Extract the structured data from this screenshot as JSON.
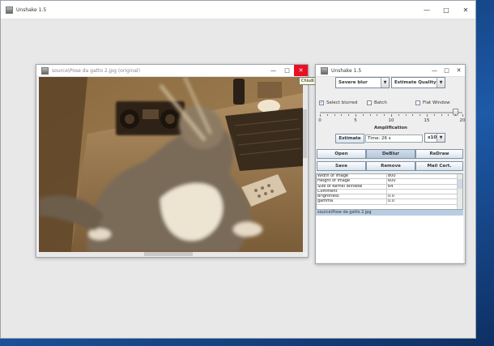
{
  "main_window": {
    "title": "Unshake 1.5"
  },
  "image_window": {
    "title": "source\\Pose da gatto 2.jpg (original)",
    "tooltip": "Chiudi"
  },
  "control_window": {
    "title": "Unshake 1.5",
    "blur_select": "Severe blur",
    "mode_select": "Estimate Quality",
    "select_blurred_label": "Select blurred",
    "select_blurred_checked": true,
    "batch_label": "Batch",
    "batch_checked": false,
    "flat_window_label": "Flat Window",
    "flat_window_checked": false,
    "amplification": {
      "label": "Amplification",
      "ticks": [
        "0",
        "5",
        "10",
        "15",
        "20"
      ],
      "value": 19
    },
    "estimate_button": "Estimate",
    "time_text": "Time: 26 s",
    "kernel_select": "x10",
    "buttons_row1": [
      "Open",
      "DeBlur",
      "ReDraw"
    ],
    "buttons_row2": [
      "Save",
      "Remove",
      "Mail Cert."
    ],
    "properties": [
      {
        "key": "Width of image",
        "value": "800"
      },
      {
        "key": "Height of image",
        "value": "600"
      },
      {
        "key": "Size of Kernel Window",
        "value": "64"
      },
      {
        "key": "Comment",
        "value": ""
      },
      {
        "key": "Brightness",
        "value": "0.0"
      },
      {
        "key": "gamma",
        "value": "0.0"
      }
    ],
    "file_list_selected": "source\\Pose da gatto 2.jpg"
  }
}
